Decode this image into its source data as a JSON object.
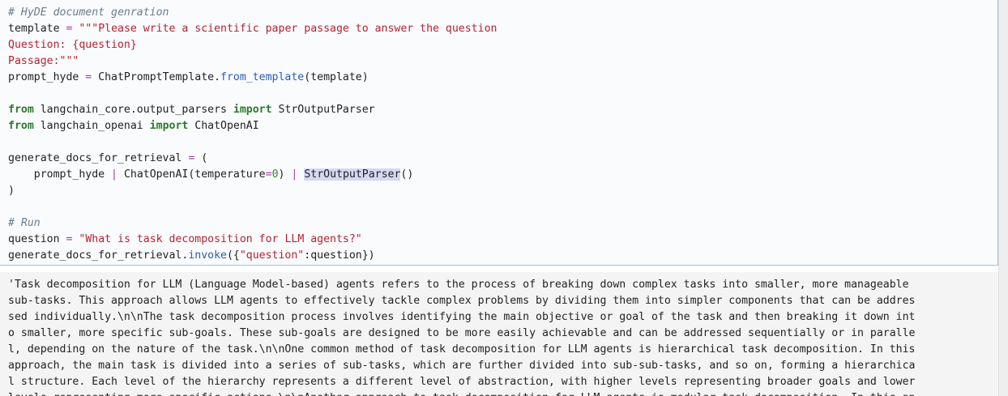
{
  "code_lines": [
    [
      {
        "t": "# HyDE document genration",
        "c": "cm"
      }
    ],
    [
      {
        "t": "template ",
        "c": ""
      },
      {
        "t": "=",
        "c": "op"
      },
      {
        "t": " ",
        "c": ""
      },
      {
        "t": "\"\"\"Please write a scientific paper passage to answer the question",
        "c": "st"
      }
    ],
    [
      {
        "t": "Question: {question}",
        "c": "st"
      }
    ],
    [
      {
        "t": "Passage:\"\"\"",
        "c": "st"
      }
    ],
    [
      {
        "t": "prompt_hyde ",
        "c": ""
      },
      {
        "t": "=",
        "c": "op"
      },
      {
        "t": " ChatPromptTemplate.",
        "c": ""
      },
      {
        "t": "from_template",
        "c": "fn"
      },
      {
        "t": "(template)",
        "c": ""
      }
    ],
    [
      {
        "t": "",
        "c": ""
      }
    ],
    [
      {
        "t": "from",
        "c": "kw"
      },
      {
        "t": " langchain_core.output_parsers ",
        "c": ""
      },
      {
        "t": "import",
        "c": "kw"
      },
      {
        "t": " StrOutputParser",
        "c": ""
      }
    ],
    [
      {
        "t": "from",
        "c": "kw"
      },
      {
        "t": " langchain_openai ",
        "c": ""
      },
      {
        "t": "import",
        "c": "kw"
      },
      {
        "t": " ChatOpenAI",
        "c": ""
      }
    ],
    [
      {
        "t": "",
        "c": ""
      }
    ],
    [
      {
        "t": "generate_docs_for_retrieval ",
        "c": ""
      },
      {
        "t": "=",
        "c": "op"
      },
      {
        "t": " (",
        "c": ""
      }
    ],
    [
      {
        "t": "    prompt_hyde ",
        "c": ""
      },
      {
        "t": "|",
        "c": "op"
      },
      {
        "t": " ChatOpenAI(temperature",
        "c": ""
      },
      {
        "t": "=",
        "c": "op"
      },
      {
        "t": "0",
        "c": "nm"
      },
      {
        "t": ") ",
        "c": ""
      },
      {
        "t": "|",
        "c": "op"
      },
      {
        "t": " ",
        "c": ""
      },
      {
        "t": "StrOutputParser",
        "c": "hl"
      },
      {
        "t": "()",
        "c": ""
      }
    ],
    [
      {
        "t": ")",
        "c": ""
      }
    ],
    [
      {
        "t": "",
        "c": ""
      }
    ],
    [
      {
        "t": "# Run",
        "c": "cm"
      }
    ],
    [
      {
        "t": "question ",
        "c": ""
      },
      {
        "t": "=",
        "c": "op"
      },
      {
        "t": " ",
        "c": ""
      },
      {
        "t": "\"What is task decomposition for LLM agents?\"",
        "c": "st"
      }
    ],
    [
      {
        "t": "generate_docs_for_retrieval.",
        "c": ""
      },
      {
        "t": "invoke",
        "c": "fn"
      },
      {
        "t": "({",
        "c": ""
      },
      {
        "t": "\"question\"",
        "c": "st"
      },
      {
        "t": ":question})",
        "c": ""
      }
    ]
  ],
  "output_lines": [
    "'Task decomposition for LLM (Language Model-based) agents refers to the process of breaking down complex tasks into smaller, more manageable",
    "sub-tasks. This approach allows LLM agents to effectively tackle complex problems by dividing them into simpler components that can be addres",
    "sed individually.\\n\\nThe task decomposition process involves identifying the main objective or goal of the task and then breaking it down int",
    "o smaller, more specific sub-goals. These sub-goals are designed to be more easily achievable and can be addressed sequentially or in paralle",
    "l, depending on the nature of the task.\\n\\nOne common method of task decomposition for LLM agents is hierarchical task decomposition. In this",
    "approach, the main task is divided into a series of sub-tasks, which are further divided into sub-sub-tasks, and so on, forming a hierarchica",
    "l structure. Each level of the hierarchy represents a different level of abstraction, with higher levels representing broader goals and lower",
    "levels representing more specific actions.\\n\\nAnother approach to task decomposition for LLM agents is modular task decomposition. In this ap"
  ]
}
